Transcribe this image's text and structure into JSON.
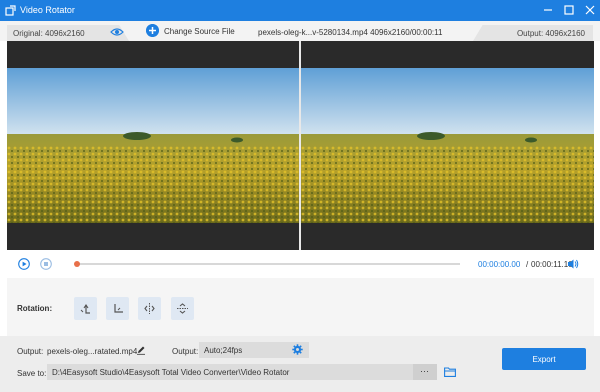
{
  "window": {
    "title": "Video Rotator"
  },
  "info_bar": {
    "original_label": "Original: 4096x2160",
    "change_source_label": "Change Source File",
    "file_info": "pexels-oleg-k...v-5280134.mp4   4096x2160/00:00:11",
    "output_label": "Output: 4096x2160"
  },
  "player": {
    "current_time": "00:00:00.00",
    "separator": "/",
    "total_time": "00:00:11.10",
    "progress": 0.0
  },
  "rotation": {
    "label": "Rotation:"
  },
  "output": {
    "label": "Output:",
    "file_name": "pexels-oleg...ratated.mp4",
    "format_label": "Output:",
    "format_value": "Auto;24fps"
  },
  "save": {
    "label": "Save to:",
    "path": "D:\\4Easysoft Studio\\4Easysoft Total Video Converter\\Video Rotator",
    "browse_label": "···"
  },
  "export": {
    "label": "Export"
  },
  "colors": {
    "accent": "#1e7fe0",
    "progress_knob": "#e8704a"
  }
}
